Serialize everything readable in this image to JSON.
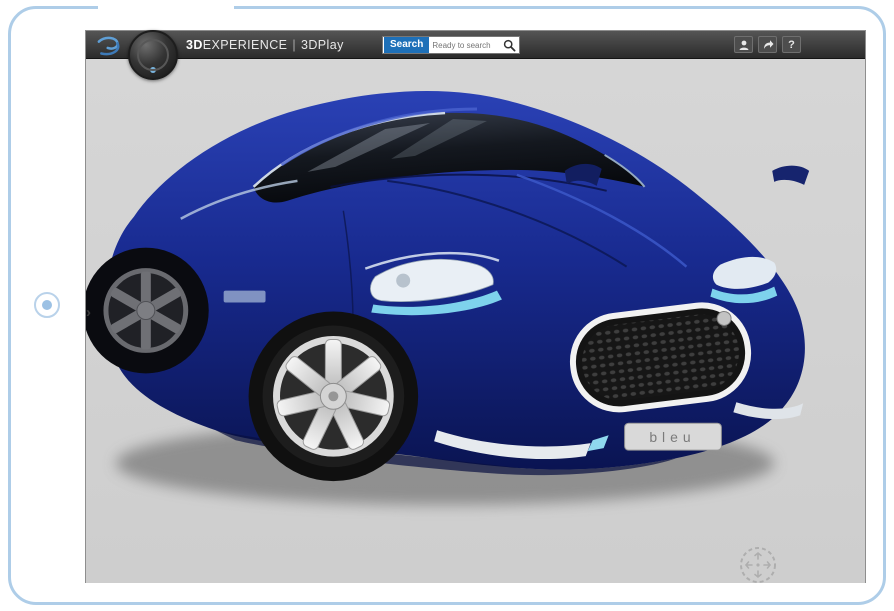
{
  "colors": {
    "header_bg": "#3a3a3a",
    "accent_blue": "#1e70b8",
    "car_blue": "#16246e",
    "headlight_cyan": "#7ed2ec",
    "viewport_bg": "#d2d2d2",
    "frame_border": "#aecde8"
  },
  "header": {
    "logo_name": "3ds-logo",
    "title_bold": "3D",
    "title_rest": "EXPERIENCE",
    "title_divider": "|",
    "title_app": "3DPlay",
    "search": {
      "button_label": "Search",
      "placeholder": "Ready to search"
    },
    "help_label": "?"
  },
  "viewport": {
    "panel_toggle_glyph": "›",
    "license_plate": "bleu",
    "model_description": "blue concept sports car, front three-quarter view"
  }
}
